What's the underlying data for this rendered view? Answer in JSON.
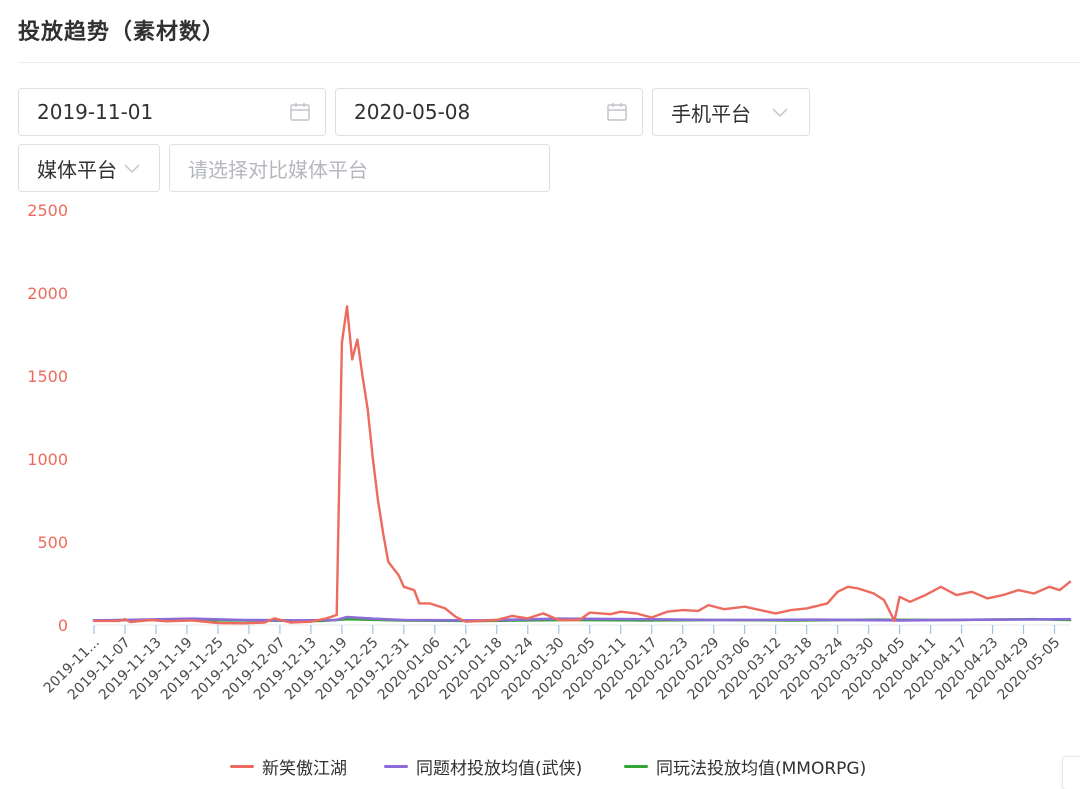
{
  "panel": {
    "title": "投放趋势（素材数）"
  },
  "filters": {
    "start_date": "2019-11-01",
    "end_date": "2020-05-08",
    "device_platform": "手机平台",
    "media_platform": "媒体平台",
    "compare_placeholder": "请选择对比媒体平台"
  },
  "icons": {
    "calendar": "calendar-icon",
    "dropdown": "chevron-down-icon"
  },
  "colors": {
    "series_main": "#ec6b5e",
    "series_theme": "#8a6bd8",
    "series_gameplay": "#33a532",
    "axis_label": "#ec6b5e"
  },
  "chart_data": {
    "type": "line",
    "ylim": [
      0,
      2500
    ],
    "yticks": [
      0,
      500,
      1000,
      1500,
      2000,
      2500
    ],
    "x_start": "2019-11-01",
    "x_end": "2020-05-08",
    "xtick_labels": [
      "2019-11...",
      "2019-11-07",
      "2019-11-13",
      "2019-11-19",
      "2019-11-25",
      "2019-12-01",
      "2019-12-07",
      "2019-12-13",
      "2019-12-19",
      "2019-12-25",
      "2019-12-31",
      "2020-01-06",
      "2020-01-12",
      "2020-01-18",
      "2020-01-24",
      "2020-01-30",
      "2020-02-05",
      "2020-02-11",
      "2020-02-17",
      "2020-02-23",
      "2020-02-29",
      "2020-03-06",
      "2020-03-12",
      "2020-03-18",
      "2020-03-24",
      "2020-03-30",
      "2020-04-05",
      "2020-04-11",
      "2020-04-17",
      "2020-04-23",
      "2020-04-29",
      "2020-05-05"
    ],
    "series": [
      {
        "name": "新笑傲江湖",
        "points": [
          [
            "2019-11-01",
            25
          ],
          [
            "2019-11-06",
            25
          ],
          [
            "2019-11-07",
            35
          ],
          [
            "2019-11-08",
            18
          ],
          [
            "2019-11-12",
            30
          ],
          [
            "2019-11-15",
            22
          ],
          [
            "2019-11-20",
            28
          ],
          [
            "2019-11-25",
            12
          ],
          [
            "2019-11-30",
            10
          ],
          [
            "2019-12-04",
            15
          ],
          [
            "2019-12-06",
            40
          ],
          [
            "2019-12-09",
            15
          ],
          [
            "2019-12-13",
            20
          ],
          [
            "2019-12-16",
            40
          ],
          [
            "2019-12-18",
            60
          ],
          [
            "2019-12-19",
            1700
          ],
          [
            "2019-12-20",
            1920
          ],
          [
            "2019-12-21",
            1600
          ],
          [
            "2019-12-22",
            1720
          ],
          [
            "2019-12-23",
            1500
          ],
          [
            "2019-12-24",
            1300
          ],
          [
            "2019-12-25",
            1000
          ],
          [
            "2019-12-26",
            750
          ],
          [
            "2019-12-27",
            550
          ],
          [
            "2019-12-28",
            380
          ],
          [
            "2019-12-30",
            300
          ],
          [
            "2019-12-31",
            230
          ],
          [
            "2020-01-02",
            210
          ],
          [
            "2020-01-03",
            130
          ],
          [
            "2020-01-05",
            130
          ],
          [
            "2020-01-08",
            100
          ],
          [
            "2020-01-10",
            50
          ],
          [
            "2020-01-12",
            20
          ],
          [
            "2020-01-18",
            30
          ],
          [
            "2020-01-21",
            55
          ],
          [
            "2020-01-24",
            40
          ],
          [
            "2020-01-27",
            70
          ],
          [
            "2020-01-30",
            30
          ],
          [
            "2020-02-03",
            30
          ],
          [
            "2020-02-05",
            75
          ],
          [
            "2020-02-09",
            65
          ],
          [
            "2020-02-11",
            80
          ],
          [
            "2020-02-14",
            70
          ],
          [
            "2020-02-17",
            45
          ],
          [
            "2020-02-20",
            80
          ],
          [
            "2020-02-23",
            90
          ],
          [
            "2020-02-26",
            85
          ],
          [
            "2020-02-28",
            120
          ],
          [
            "2020-03-02",
            95
          ],
          [
            "2020-03-06",
            110
          ],
          [
            "2020-03-09",
            90
          ],
          [
            "2020-03-12",
            70
          ],
          [
            "2020-03-15",
            90
          ],
          [
            "2020-03-18",
            100
          ],
          [
            "2020-03-22",
            130
          ],
          [
            "2020-03-24",
            200
          ],
          [
            "2020-03-26",
            230
          ],
          [
            "2020-03-28",
            220
          ],
          [
            "2020-03-31",
            190
          ],
          [
            "2020-04-02",
            150
          ],
          [
            "2020-04-04",
            25
          ],
          [
            "2020-04-05",
            170
          ],
          [
            "2020-04-07",
            140
          ],
          [
            "2020-04-10",
            180
          ],
          [
            "2020-04-13",
            230
          ],
          [
            "2020-04-16",
            180
          ],
          [
            "2020-04-19",
            200
          ],
          [
            "2020-04-22",
            160
          ],
          [
            "2020-04-25",
            180
          ],
          [
            "2020-04-28",
            210
          ],
          [
            "2020-05-01",
            190
          ],
          [
            "2020-05-04",
            230
          ],
          [
            "2020-05-06",
            210
          ],
          [
            "2020-05-08",
            260
          ]
        ]
      },
      {
        "name": "同题材投放均值(武侠)",
        "points": [
          [
            "2019-11-01",
            28
          ],
          [
            "2019-11-10",
            32
          ],
          [
            "2019-11-20",
            38
          ],
          [
            "2019-11-30",
            30
          ],
          [
            "2019-12-10",
            28
          ],
          [
            "2019-12-18",
            30
          ],
          [
            "2019-12-20",
            48
          ],
          [
            "2019-12-25",
            38
          ],
          [
            "2019-12-31",
            30
          ],
          [
            "2020-01-15",
            28
          ],
          [
            "2020-01-30",
            38
          ],
          [
            "2020-02-15",
            35
          ],
          [
            "2020-03-01",
            30
          ],
          [
            "2020-03-20",
            32
          ],
          [
            "2020-04-05",
            28
          ],
          [
            "2020-04-20",
            32
          ],
          [
            "2020-05-08",
            35
          ]
        ]
      },
      {
        "name": "同玩法投放均值(MMORPG)",
        "points": [
          [
            "2019-11-01",
            28
          ],
          [
            "2019-11-15",
            30
          ],
          [
            "2019-12-01",
            28
          ],
          [
            "2019-12-15",
            25
          ],
          [
            "2019-12-20",
            35
          ],
          [
            "2019-12-31",
            28
          ],
          [
            "2020-01-15",
            25
          ],
          [
            "2020-02-01",
            30
          ],
          [
            "2020-02-15",
            28
          ],
          [
            "2020-03-01",
            30
          ],
          [
            "2020-03-15",
            28
          ],
          [
            "2020-04-01",
            32
          ],
          [
            "2020-04-15",
            30
          ],
          [
            "2020-05-01",
            35
          ],
          [
            "2020-05-08",
            30
          ]
        ]
      }
    ]
  },
  "legend": {
    "items": [
      {
        "label": "新笑傲江湖",
        "color": "#ec6b5e"
      },
      {
        "label": "同题材投放均值(武侠)",
        "color": "#8a6bd8"
      },
      {
        "label": "同玩法投放均值(MMORPG)",
        "color": "#33a532"
      }
    ]
  }
}
